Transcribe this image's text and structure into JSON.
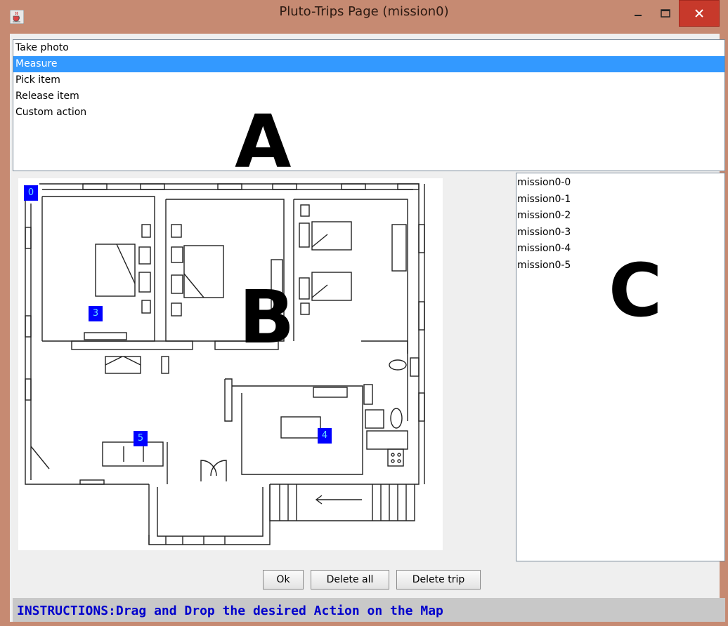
{
  "window": {
    "title": "Pluto-Trips Page (mission0)",
    "icon": "java-cup-icon",
    "controls": [
      "minimize",
      "maximize",
      "close"
    ],
    "close_color": "#c7392b"
  },
  "actions": {
    "items": [
      "Take photo",
      "Measure",
      "Pick item",
      "Release item",
      "Custom action"
    ],
    "selected": "Measure",
    "selected_color": "#3399ff"
  },
  "labels": {
    "a": "A",
    "b": "B",
    "c": "C"
  },
  "map": {
    "markers": [
      {
        "id": "0",
        "label": "0"
      },
      {
        "id": "3",
        "label": "3"
      },
      {
        "id": "4",
        "label": "4"
      },
      {
        "id": "5",
        "label": "5"
      }
    ],
    "marker_color": "#0000ff"
  },
  "trips": {
    "items": [
      "mission0-0",
      "mission0-1",
      "mission0-2",
      "mission0-3",
      "mission0-4",
      "mission0-5"
    ]
  },
  "buttons": {
    "ok": "Ok",
    "delete_all": "Delete all",
    "delete_trip": "Delete trip"
  },
  "instructions": "INSTRUCTIONS:Drag and Drop the desired Action on the Map"
}
